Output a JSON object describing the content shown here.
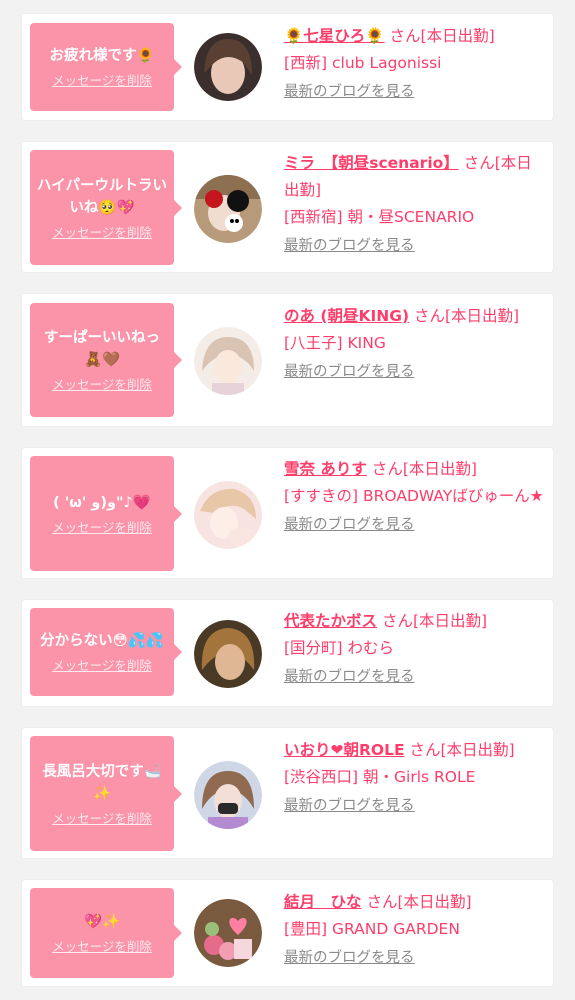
{
  "delete_label": "メッセージを削除",
  "blog_label": "最新のブログを見る",
  "suffix": " さん[本日出勤]",
  "colors": {
    "bubble": "#fb93a9",
    "accent": "#ff3d6a",
    "link_gray": "#8a8a8a",
    "background": "#f2f2f2"
  },
  "items": [
    {
      "message": "お疲れ様です🌻",
      "name": "🌻七星ひろ🌻",
      "shop": "[西新] club Lagonissi"
    },
    {
      "message": "ハイパーウルトラいいね🥺💖",
      "name": "ミラ　【朝昼scenario】",
      "shop": "[西新宿] 朝・昼SCENARIO"
    },
    {
      "message": "すーぱーいいねっ🧸🤎",
      "name": "のあ (朝昼KING)",
      "shop": "[八王子] KING"
    },
    {
      "message": "( 'ω' و(و\"♪💗",
      "name": "雪奈 ありす",
      "shop": "[すすきの] BROADWAYばびゅーん★"
    },
    {
      "message": "分からない😳💦💦",
      "name": "代表たかボス",
      "shop": "[国分町] わむら"
    },
    {
      "message": "長風呂大切です🛁✨",
      "name": "いおり❤朝ROLE",
      "shop": "[渋谷西口] 朝・Girls ROLE"
    },
    {
      "message": "💖✨",
      "name": "結月　ひな",
      "shop": "[豊田] GRAND GARDEN"
    }
  ]
}
